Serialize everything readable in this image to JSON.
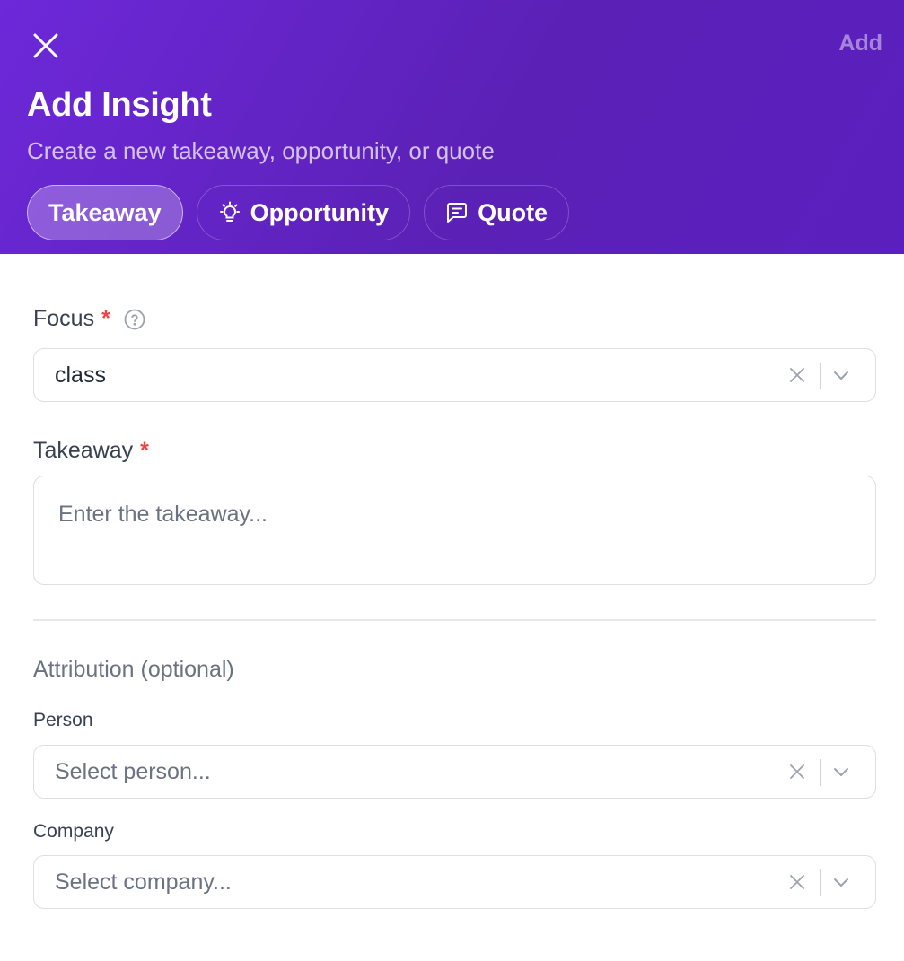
{
  "header": {
    "add_label": "Add",
    "title": "Add Insight",
    "subtitle": "Create a new takeaway, opportunity, or quote",
    "tabs": [
      {
        "label": "Takeaway",
        "icon": "none",
        "active": true
      },
      {
        "label": "Opportunity",
        "icon": "lightbulb-icon",
        "active": false
      },
      {
        "label": "Quote",
        "icon": "message-square-icon",
        "active": false
      }
    ]
  },
  "form": {
    "focus": {
      "label": "Focus",
      "required_mark": "*",
      "value": "class"
    },
    "takeaway": {
      "label": "Takeaway",
      "required_mark": "*",
      "placeholder": "Enter the takeaway..."
    },
    "attribution": {
      "title": "Attribution (optional)",
      "person": {
        "label": "Person",
        "placeholder": "Select person..."
      },
      "company": {
        "label": "Company",
        "placeholder": "Select company..."
      }
    }
  },
  "colors": {
    "header_gradient_start": "#6d28d9",
    "header_gradient_end": "#5b1fbf",
    "required": "#ef4444",
    "border": "#dcdfe4"
  }
}
